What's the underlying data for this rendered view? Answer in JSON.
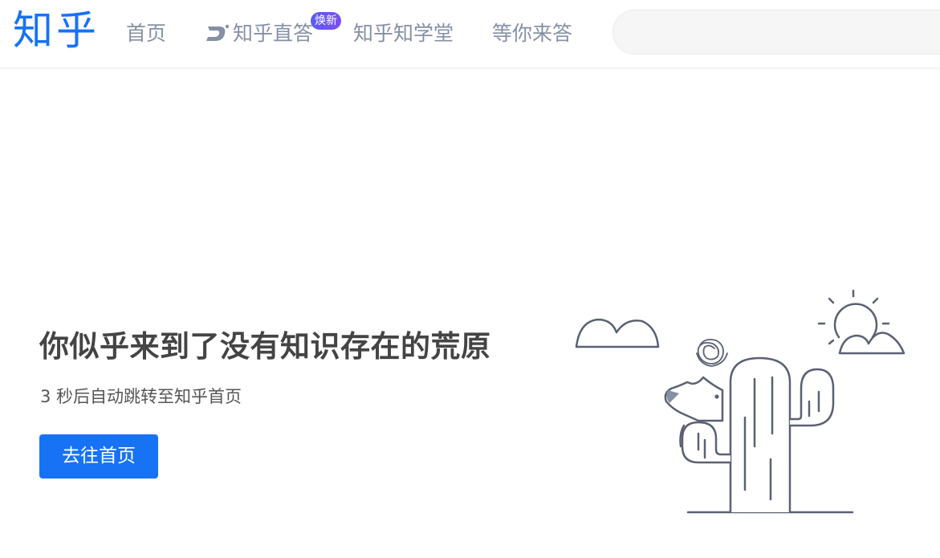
{
  "header": {
    "logo": "知乎",
    "nav": [
      {
        "label": "首页"
      },
      {
        "label": "知乎直答"
      },
      {
        "label": "知乎知学堂"
      },
      {
        "label": "等你来答"
      }
    ],
    "badge": "焕新",
    "search_value": ""
  },
  "main": {
    "title": "你似乎来到了没有知识存在的荒原",
    "subtitle": "3 秒后自动跳转至知乎首页",
    "button_label": "去往首页"
  },
  "illustration": {
    "icons": [
      "cloud-icon",
      "sun-icon",
      "cactus-icon",
      "fox-icon",
      "scribble-icon"
    ]
  },
  "colors": {
    "brand": "#1772f6",
    "nav_text": "#8590a6",
    "badge_start": "#5b5cf6",
    "badge_end": "#7b4ef0",
    "illustration_stroke": "#5a6173"
  }
}
